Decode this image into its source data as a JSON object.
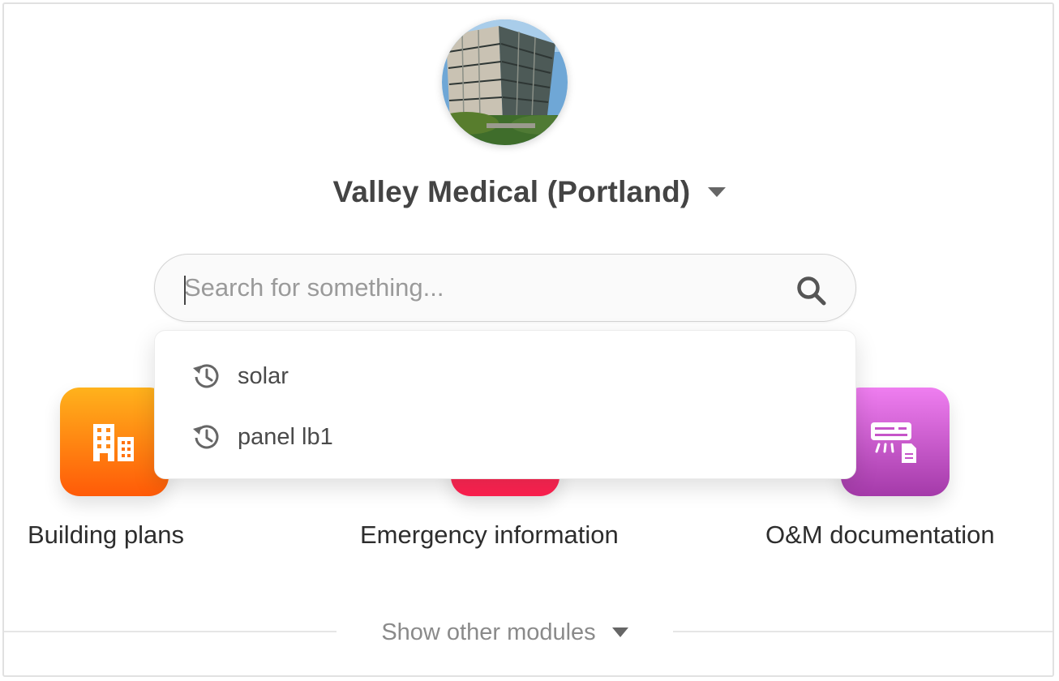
{
  "site": {
    "name": "Valley Medical (Portland)",
    "avatar_icon": "building-photo"
  },
  "search": {
    "placeholder": "Search for something...",
    "value": "",
    "icon": "search-icon"
  },
  "recent_searches": [
    {
      "label": "solar",
      "icon": "history-icon"
    },
    {
      "label": "panel lb1",
      "icon": "history-icon"
    }
  ],
  "modules": [
    {
      "label": "Building plans",
      "icon": "buildings-icon",
      "color": "#ff7a10"
    },
    {
      "label": "Emergency information",
      "icon": "emergency-icon",
      "color": "#ff2a55"
    },
    {
      "label": "O&M documentation",
      "icon": "hvac-document-icon",
      "color": "#c654c9"
    }
  ],
  "footer": {
    "show_other_label": "Show other modules"
  }
}
